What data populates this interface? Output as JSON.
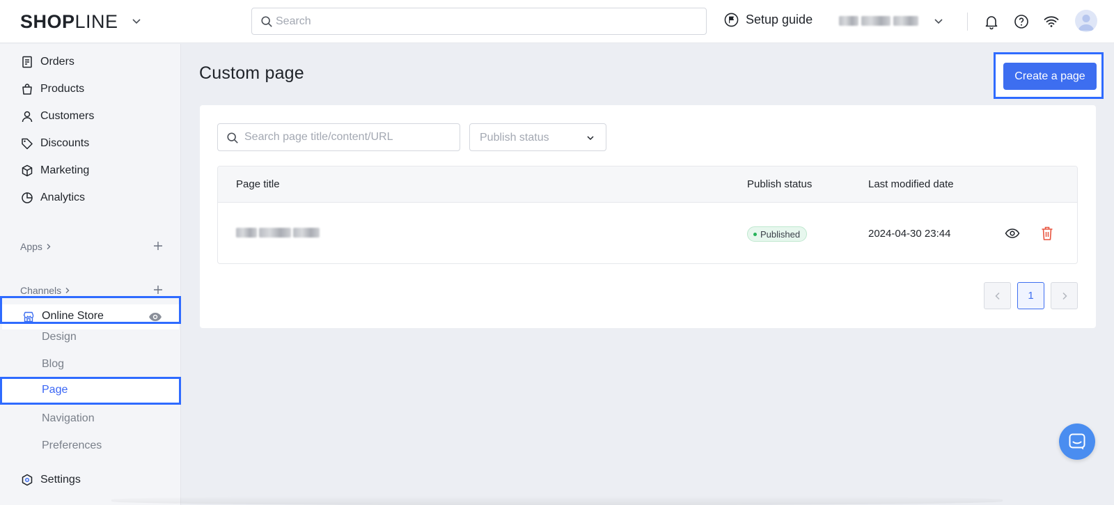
{
  "topbar": {
    "logo_bold": "SHOP",
    "logo_light": "LINE",
    "search_placeholder": "Search",
    "setup_guide": "Setup guide"
  },
  "sidebar": {
    "items": [
      {
        "label": "Orders",
        "icon": "orders-icon"
      },
      {
        "label": "Products",
        "icon": "bag-icon"
      },
      {
        "label": "Customers",
        "icon": "person-icon"
      },
      {
        "label": "Discounts",
        "icon": "tag-icon"
      },
      {
        "label": "Marketing",
        "icon": "cube-icon"
      },
      {
        "label": "Analytics",
        "icon": "pie-chart-icon"
      }
    ],
    "apps_label": "Apps",
    "channels_label": "Channels",
    "online_store_label": "Online Store",
    "online_store_sub": [
      {
        "label": "Design"
      },
      {
        "label": "Blog"
      },
      {
        "label": "Page",
        "active": true
      },
      {
        "label": "Navigation"
      },
      {
        "label": "Preferences"
      }
    ],
    "settings_label": "Settings"
  },
  "main": {
    "title": "Custom page",
    "create_button": "Create a page",
    "filter_search_placeholder": "Search page title/content/URL",
    "filter_status_placeholder": "Publish status",
    "columns": [
      "Page title",
      "Publish status",
      "Last modified date"
    ],
    "rows": [
      {
        "status": "Published",
        "modified": "2024-04-30 23:44"
      }
    ],
    "pagination": {
      "current": "1"
    }
  },
  "colors": {
    "accent": "#3d6ef0",
    "highlight": "#2f6bff",
    "published_green": "#27b35a",
    "delete_red": "#e8543f"
  }
}
